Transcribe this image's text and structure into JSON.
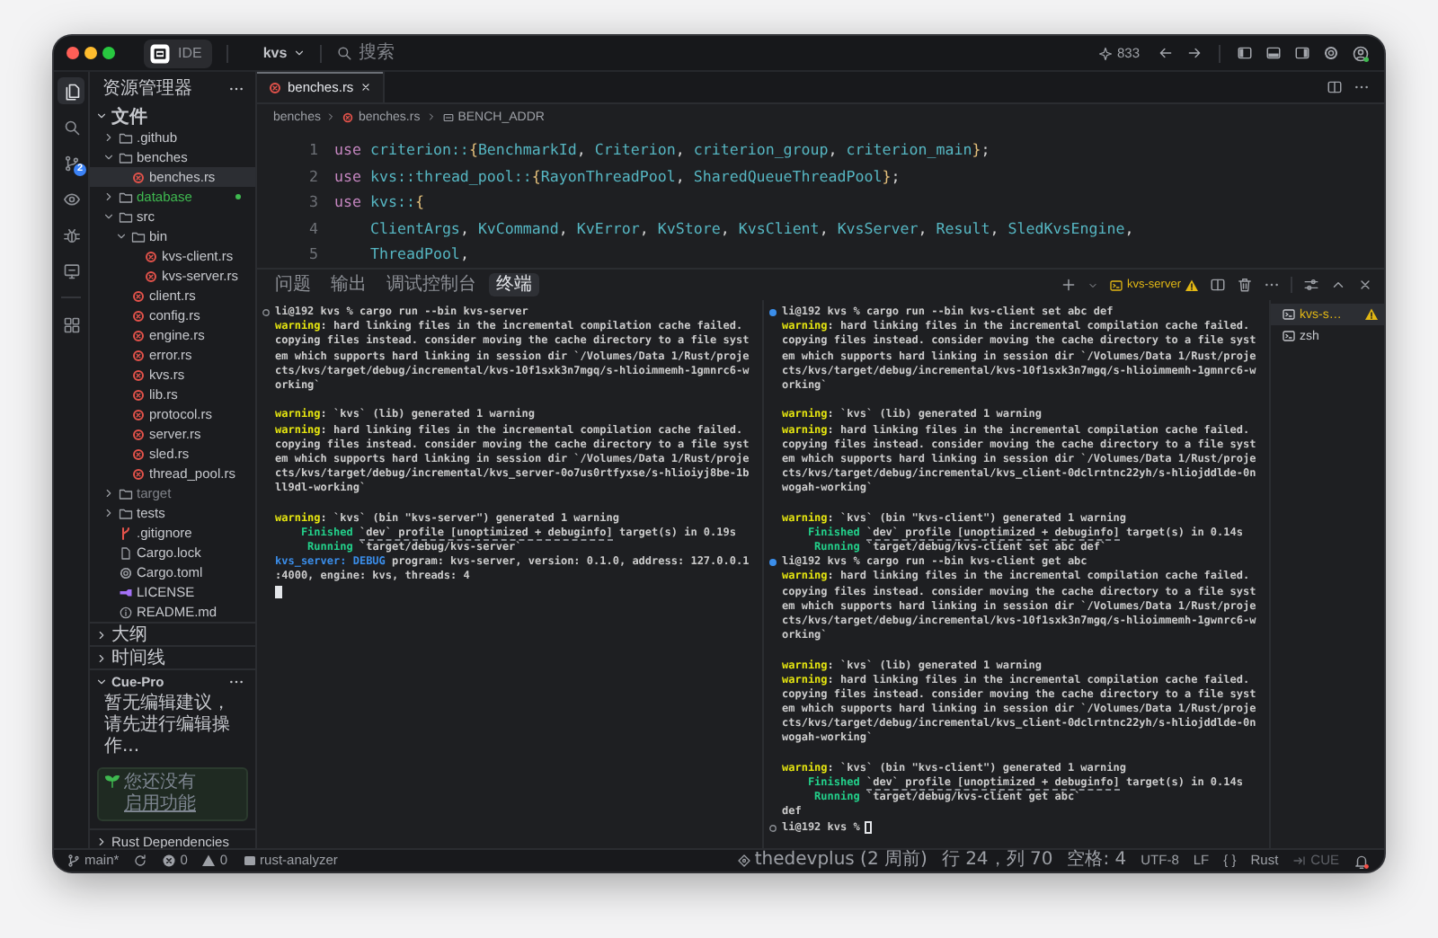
{
  "titlebar": {
    "product": "IDE",
    "project": "kvs",
    "search": {
      "placeholder": "搜索"
    },
    "usage": "833"
  },
  "activity_bar": [
    {
      "kind": "files",
      "selected": true
    },
    {
      "kind": "search",
      "selected": false
    },
    {
      "kind": "source-control",
      "selected": false,
      "badge": "2"
    },
    {
      "kind": "preview",
      "selected": false
    },
    {
      "kind": "debug",
      "selected": false
    },
    {
      "kind": "remote",
      "selected": false
    },
    {
      "kind": "extensions",
      "selected": false,
      "separator_before": true
    }
  ],
  "sidebar": {
    "title": "资源管理器",
    "section": "文件",
    "tree": [
      {
        "label": ".github",
        "kind": "folder",
        "expanded": false,
        "selected": false
      },
      {
        "label": "benches",
        "kind": "folder",
        "expanded": true,
        "selected": false,
        "children": [
          {
            "label": "benches.rs",
            "kind": "rust",
            "selected": true
          }
        ]
      },
      {
        "label": "database",
        "kind": "folder",
        "expanded": false,
        "selected": false,
        "untracked": true
      },
      {
        "label": "src",
        "kind": "folder",
        "expanded": true,
        "selected": false,
        "children": [
          {
            "label": "bin",
            "kind": "folder",
            "expanded": true,
            "selected": false,
            "children": [
              {
                "label": "kvs-client.rs",
                "kind": "rust",
                "selected": false
              },
              {
                "label": "kvs-server.rs",
                "kind": "rust",
                "selected": false
              }
            ]
          },
          {
            "label": "client.rs",
            "kind": "rust",
            "selected": false
          },
          {
            "label": "config.rs",
            "kind": "rust",
            "selected": false
          },
          {
            "label": "engine.rs",
            "kind": "rust",
            "selected": false
          },
          {
            "label": "error.rs",
            "kind": "rust",
            "selected": false
          },
          {
            "label": "kvs.rs",
            "kind": "rust",
            "selected": false
          },
          {
            "label": "lib.rs",
            "kind": "rust",
            "selected": false
          },
          {
            "label": "protocol.rs",
            "kind": "rust",
            "selected": false
          },
          {
            "label": "server.rs",
            "kind": "rust",
            "selected": false
          },
          {
            "label": "sled.rs",
            "kind": "rust",
            "selected": false
          },
          {
            "label": "thread_pool.rs",
            "kind": "rust",
            "selected": false
          }
        ]
      },
      {
        "label": "target",
        "kind": "folder",
        "expanded": false,
        "selected": false,
        "ignored": true
      },
      {
        "label": "tests",
        "kind": "folder",
        "expanded": false,
        "selected": false
      },
      {
        "label": ".gitignore",
        "kind": "git",
        "selected": false
      },
      {
        "label": "Cargo.lock",
        "kind": "lock",
        "selected": false
      },
      {
        "label": "Cargo.toml",
        "kind": "config",
        "selected": false
      },
      {
        "label": "LICENSE",
        "kind": "license",
        "selected": false
      },
      {
        "label": "README.md",
        "kind": "info",
        "selected": false
      }
    ],
    "panels": [
      {
        "title": "大纲",
        "expanded": false
      },
      {
        "title": "时间线",
        "expanded": false
      },
      {
        "title": "Cue-Pro",
        "expanded": true,
        "message": "暂无编辑建议，请先进行编辑操作...",
        "notice": "您还没有",
        "notice_link": "启用功能"
      },
      {
        "title": "Rust Dependencies",
        "expanded": false
      }
    ]
  },
  "editor": {
    "tabs": [
      {
        "label": "benches.rs",
        "selected": true
      }
    ],
    "breadcrumbs": [
      {
        "kind": "folder",
        "label": "benches"
      },
      {
        "kind": "rust",
        "label": "benches.rs"
      },
      {
        "kind": "symbol",
        "label": "BENCH_ADDR"
      }
    ],
    "lines": [
      {
        "number": "1",
        "tokens": [
          {
            "kind": "keyword",
            "text": "use "
          },
          {
            "kind": "path",
            "text": "criterion::"
          },
          {
            "kind": "brace",
            "text": "{"
          },
          {
            "kind": "path",
            "text": "BenchmarkId"
          },
          {
            "kind": "plain",
            "text": ", "
          },
          {
            "kind": "path",
            "text": "Criterion"
          },
          {
            "kind": "plain",
            "text": ", "
          },
          {
            "kind": "path",
            "text": "criterion_group"
          },
          {
            "kind": "plain",
            "text": ", "
          },
          {
            "kind": "path",
            "text": "criterion_main"
          },
          {
            "kind": "brace",
            "text": "}"
          },
          {
            "kind": "plain",
            "text": ";"
          }
        ]
      },
      {
        "number": "2",
        "tokens": [
          {
            "kind": "keyword",
            "text": "use "
          },
          {
            "kind": "path",
            "text": "kvs::thread_pool::"
          },
          {
            "kind": "brace",
            "text": "{"
          },
          {
            "kind": "path",
            "text": "RayonThreadPool"
          },
          {
            "kind": "plain",
            "text": ", "
          },
          {
            "kind": "path",
            "text": "SharedQueueThreadPool"
          },
          {
            "kind": "brace",
            "text": "}"
          },
          {
            "kind": "plain",
            "text": ";"
          }
        ]
      },
      {
        "number": "3",
        "tokens": [
          {
            "kind": "keyword",
            "text": "use "
          },
          {
            "kind": "path",
            "text": "kvs::"
          },
          {
            "kind": "brace",
            "text": "{"
          }
        ]
      },
      {
        "number": "4",
        "tokens": [
          {
            "kind": "path",
            "text": "    ClientArgs"
          },
          {
            "kind": "plain",
            "text": ", "
          },
          {
            "kind": "path",
            "text": "KvCommand"
          },
          {
            "kind": "plain",
            "text": ", "
          },
          {
            "kind": "path",
            "text": "KvError"
          },
          {
            "kind": "plain",
            "text": ", "
          },
          {
            "kind": "path",
            "text": "KvStore"
          },
          {
            "kind": "plain",
            "text": ", "
          },
          {
            "kind": "path",
            "text": "KvsClient"
          },
          {
            "kind": "plain",
            "text": ", "
          },
          {
            "kind": "path",
            "text": "KvsServer"
          },
          {
            "kind": "plain",
            "text": ", "
          },
          {
            "kind": "path",
            "text": "Result"
          },
          {
            "kind": "plain",
            "text": ", "
          },
          {
            "kind": "path",
            "text": "SledKvsEngine"
          },
          {
            "kind": "plain",
            "text": ","
          }
        ]
      },
      {
        "number": "5",
        "tokens": [
          {
            "kind": "path",
            "text": "    ThreadPool"
          },
          {
            "kind": "plain",
            "text": ","
          }
        ]
      }
    ]
  },
  "panel": {
    "tabs": [
      {
        "label": "问题",
        "selected": false
      },
      {
        "label": "输出",
        "selected": false
      },
      {
        "label": "调试控制台",
        "selected": false
      },
      {
        "label": "终端",
        "selected": true
      }
    ],
    "active_terminal": "kvs-server",
    "terminals": [
      {
        "lines": [
          {
            "kind": "prompt",
            "completed": false,
            "text": "li@192 kvs % cargo run --bin kvs-server"
          },
          {
            "kind": "output",
            "parts": [
              {
                "kind": "warning",
                "text": "warning"
              },
              {
                "kind": "plain",
                "text": ": hard linking files in the incremental compilation cache failed."
              }
            ]
          },
          {
            "kind": "output",
            "parts": [
              {
                "kind": "plain",
                "text": "copying files instead. consider moving the cache directory to a file syst"
              }
            ]
          },
          {
            "kind": "output",
            "parts": [
              {
                "kind": "plain",
                "text": "em which supports hard linking in session dir `/Volumes/Data 1/Rust/proje"
              }
            ]
          },
          {
            "kind": "output",
            "parts": [
              {
                "kind": "plain",
                "text": "cts/kvs/target/debug/incremental/kvs-10f1sxk3n7mgq/s-hlioimmemh-1gmnrc6-w"
              }
            ]
          },
          {
            "kind": "output",
            "parts": [
              {
                "kind": "plain",
                "text": "orking`"
              }
            ]
          },
          {
            "kind": "blank"
          },
          {
            "kind": "output",
            "parts": [
              {
                "kind": "warning",
                "text": "warning"
              },
              {
                "kind": "plain",
                "text": ": `kvs` (lib) generated 1 warning"
              }
            ]
          },
          {
            "kind": "output",
            "parts": [
              {
                "kind": "warning",
                "text": "warning"
              },
              {
                "kind": "plain",
                "text": ": hard linking files in the incremental compilation cache failed."
              }
            ]
          },
          {
            "kind": "output",
            "parts": [
              {
                "kind": "plain",
                "text": "copying files instead. consider moving the cache directory to a file syst"
              }
            ]
          },
          {
            "kind": "output",
            "parts": [
              {
                "kind": "plain",
                "text": "em which supports hard linking in session dir `/Volumes/Data 1/Rust/proje"
              }
            ]
          },
          {
            "kind": "output",
            "parts": [
              {
                "kind": "plain",
                "text": "cts/kvs/target/debug/incremental/kvs_server-0o7us0rtfyxse/s-hlioiyj8be-1b"
              }
            ]
          },
          {
            "kind": "output",
            "parts": [
              {
                "kind": "plain",
                "text": "ll9dl-working`"
              }
            ]
          },
          {
            "kind": "blank"
          },
          {
            "kind": "output",
            "parts": [
              {
                "kind": "warning",
                "text": "warning"
              },
              {
                "kind": "plain",
                "text": ": `kvs` (bin \"kvs-server\") generated 1 warning"
              }
            ]
          },
          {
            "kind": "output",
            "parts": [
              {
                "kind": "success",
                "text": "    Finished "
              },
              {
                "kind": "link",
                "text": "`dev` profile [unoptimized + debuginfo]"
              },
              {
                "kind": "plain",
                "text": " target(s) in 0.19s"
              }
            ]
          },
          {
            "kind": "output",
            "parts": [
              {
                "kind": "success",
                "text": "     Running"
              },
              {
                "kind": "plain",
                "text": " `target/debug/kvs-server`"
              }
            ]
          },
          {
            "kind": "output",
            "parts": [
              {
                "kind": "info",
                "text": "kvs_server: DEBUG"
              },
              {
                "kind": "plain",
                "text": " program: kvs-server, version: 0.1.0, address: 127.0.0.1"
              }
            ]
          },
          {
            "kind": "output",
            "parts": [
              {
                "kind": "plain",
                "text": ":4000, engine: kvs, threads: 4"
              }
            ]
          },
          {
            "kind": "cursor"
          }
        ]
      },
      {
        "lines": [
          {
            "kind": "prompt",
            "completed": true,
            "text": "li@192 kvs % cargo run --bin kvs-client set abc def"
          },
          {
            "kind": "output",
            "parts": [
              {
                "kind": "warning",
                "text": "warning"
              },
              {
                "kind": "plain",
                "text": ": hard linking files in the incremental compilation cache failed."
              }
            ]
          },
          {
            "kind": "output",
            "parts": [
              {
                "kind": "plain",
                "text": "copying files instead. consider moving the cache directory to a file syst"
              }
            ]
          },
          {
            "kind": "output",
            "parts": [
              {
                "kind": "plain",
                "text": "em which supports hard linking in session dir `/Volumes/Data 1/Rust/proje"
              }
            ]
          },
          {
            "kind": "output",
            "parts": [
              {
                "kind": "plain",
                "text": "cts/kvs/target/debug/incremental/kvs-10f1sxk3n7mgq/s-hlioimmemh-1gmnrc6-w"
              }
            ]
          },
          {
            "kind": "output",
            "parts": [
              {
                "kind": "plain",
                "text": "orking`"
              }
            ]
          },
          {
            "kind": "blank"
          },
          {
            "kind": "output",
            "parts": [
              {
                "kind": "warning",
                "text": "warning"
              },
              {
                "kind": "plain",
                "text": ": `kvs` (lib) generated 1 warning"
              }
            ]
          },
          {
            "kind": "output",
            "parts": [
              {
                "kind": "warning",
                "text": "warning"
              },
              {
                "kind": "plain",
                "text": ": hard linking files in the incremental compilation cache failed."
              }
            ]
          },
          {
            "kind": "output",
            "parts": [
              {
                "kind": "plain",
                "text": "copying files instead. consider moving the cache directory to a file syst"
              }
            ]
          },
          {
            "kind": "output",
            "parts": [
              {
                "kind": "plain",
                "text": "em which supports hard linking in session dir `/Volumes/Data 1/Rust/proje"
              }
            ]
          },
          {
            "kind": "output",
            "parts": [
              {
                "kind": "plain",
                "text": "cts/kvs/target/debug/incremental/kvs_client-0dclrntnc22yh/s-hliojddlde-0n"
              }
            ]
          },
          {
            "kind": "output",
            "parts": [
              {
                "kind": "plain",
                "text": "wogah-working`"
              }
            ]
          },
          {
            "kind": "blank"
          },
          {
            "kind": "output",
            "parts": [
              {
                "kind": "warning",
                "text": "warning"
              },
              {
                "kind": "plain",
                "text": ": `kvs` (bin \"kvs-client\") generated 1 warning"
              }
            ]
          },
          {
            "kind": "output",
            "parts": [
              {
                "kind": "success",
                "text": "    Finished "
              },
              {
                "kind": "link",
                "text": "`dev` profile [unoptimized + debuginfo]"
              },
              {
                "kind": "plain",
                "text": " target(s) in 0.14s"
              }
            ]
          },
          {
            "kind": "output",
            "parts": [
              {
                "kind": "success",
                "text": "     Running"
              },
              {
                "kind": "plain",
                "text": " `target/debug/kvs-client set abc def`"
              }
            ]
          },
          {
            "kind": "prompt",
            "completed": true,
            "text": "li@192 kvs % cargo run --bin kvs-client get abc"
          },
          {
            "kind": "output",
            "parts": [
              {
                "kind": "warning",
                "text": "warning"
              },
              {
                "kind": "plain",
                "text": ": hard linking files in the incremental compilation cache failed."
              }
            ]
          },
          {
            "kind": "output",
            "parts": [
              {
                "kind": "plain",
                "text": "copying files instead. consider moving the cache directory to a file syst"
              }
            ]
          },
          {
            "kind": "output",
            "parts": [
              {
                "kind": "plain",
                "text": "em which supports hard linking in session dir `/Volumes/Data 1/Rust/proje"
              }
            ]
          },
          {
            "kind": "output",
            "parts": [
              {
                "kind": "plain",
                "text": "cts/kvs/target/debug/incremental/kvs-10f1sxk3n7mgq/s-hlioimmemh-1gwnrc6-w"
              }
            ]
          },
          {
            "kind": "output",
            "parts": [
              {
                "kind": "plain",
                "text": "orking`"
              }
            ]
          },
          {
            "kind": "blank"
          },
          {
            "kind": "output",
            "parts": [
              {
                "kind": "warning",
                "text": "warning"
              },
              {
                "kind": "plain",
                "text": ": `kvs` (lib) generated 1 warning"
              }
            ]
          },
          {
            "kind": "output",
            "parts": [
              {
                "kind": "warning",
                "text": "warning"
              },
              {
                "kind": "plain",
                "text": ": hard linking files in the incremental compilation cache failed."
              }
            ]
          },
          {
            "kind": "output",
            "parts": [
              {
                "kind": "plain",
                "text": "copying files instead. consider moving the cache directory to a file syst"
              }
            ]
          },
          {
            "kind": "output",
            "parts": [
              {
                "kind": "plain",
                "text": "em which supports hard linking in session dir `/Volumes/Data 1/Rust/proje"
              }
            ]
          },
          {
            "kind": "output",
            "parts": [
              {
                "kind": "plain",
                "text": "cts/kvs/target/debug/incremental/kvs_client-0dclrntnc22yh/s-hliojddlde-0n"
              }
            ]
          },
          {
            "kind": "output",
            "parts": [
              {
                "kind": "plain",
                "text": "wogah-working`"
              }
            ]
          },
          {
            "kind": "blank"
          },
          {
            "kind": "output",
            "parts": [
              {
                "kind": "warning",
                "text": "warning"
              },
              {
                "kind": "plain",
                "text": ": `kvs` (bin \"kvs-client\") generated 1 warning"
              }
            ]
          },
          {
            "kind": "output",
            "parts": [
              {
                "kind": "success",
                "text": "    Finished "
              },
              {
                "kind": "link",
                "text": "`dev` profile [unoptimized + debuginfo]"
              },
              {
                "kind": "plain",
                "text": " target(s) in 0.14s"
              }
            ]
          },
          {
            "kind": "output",
            "parts": [
              {
                "kind": "success",
                "text": "     Running"
              },
              {
                "kind": "plain",
                "text": " `target/debug/kvs-client get abc`"
              }
            ]
          },
          {
            "kind": "output",
            "parts": [
              {
                "kind": "plain",
                "text": "def"
              }
            ]
          },
          {
            "kind": "prompt",
            "completed": false,
            "cursor": true,
            "text": "li@192 kvs %"
          }
        ]
      }
    ],
    "terminal_list": [
      {
        "label": "kvs-s…",
        "selected": true,
        "warning": true
      },
      {
        "label": "zsh",
        "selected": false,
        "warning": false
      }
    ]
  },
  "status_bar": {
    "branch": "main*",
    "errors": "0",
    "warnings": "0",
    "language_server": "rust-analyzer",
    "blame": "thedevplus (2 周前)",
    "cursor_position": "行 24，列 70",
    "indentation": "空格: 4",
    "encoding": "UTF-8",
    "line_ending": "LF",
    "brackets": "{ }",
    "language": "Rust",
    "cue": {
      "label": "CUE",
      "disabled": true
    }
  }
}
